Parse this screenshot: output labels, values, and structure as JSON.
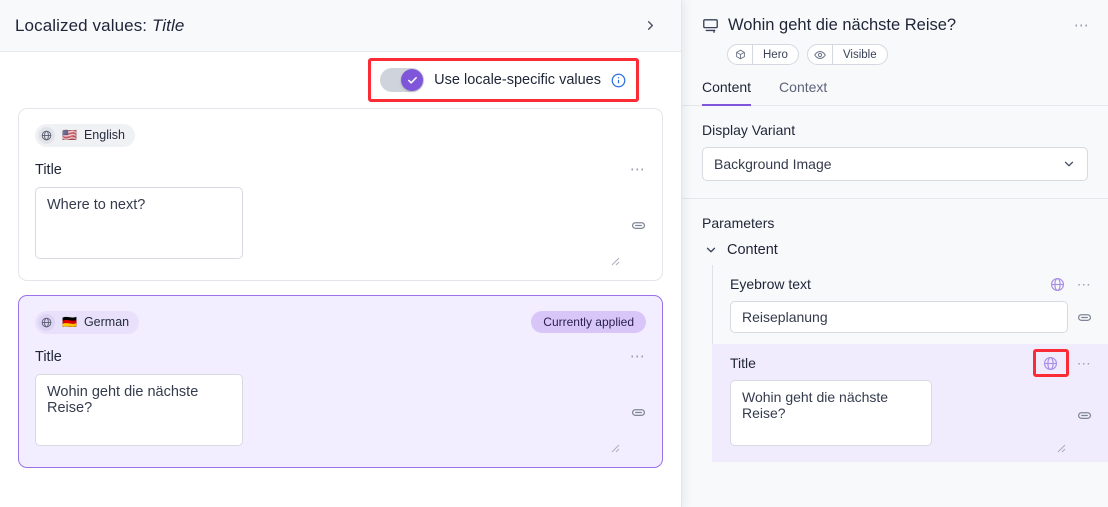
{
  "left_panel": {
    "header": {
      "title_prefix": "Localized values:",
      "title_value": "Title",
      "collapse_icon": "chevron-right-icon"
    },
    "toggle": {
      "label": "Use locale-specific values",
      "state": "on",
      "info_icon": "info-circle-icon",
      "annotation_color": "#fb2c36"
    },
    "locale_cards": [
      {
        "globe_icon": "globe-icon",
        "flag": "🇺🇸",
        "locale_name": "English",
        "badge": "",
        "field_label": "Title",
        "value": "Where to next?",
        "menu_icon": "ellipsis-icon",
        "link_icon": "link-icon",
        "applied": false
      },
      {
        "globe_icon": "globe-icon",
        "flag": "🇩🇪",
        "locale_name": "German",
        "badge": "Currently applied",
        "field_label": "Title",
        "value": "Wohin geht die nächste Reise?",
        "menu_icon": "ellipsis-icon",
        "link_icon": "link-icon",
        "applied": true
      }
    ]
  },
  "right_panel": {
    "header": {
      "icon": "section-layout-icon",
      "title": "Wohin geht die nächste Reise?",
      "menu_icon": "ellipsis-icon",
      "badges": [
        {
          "icon": "cube-icon",
          "label": "Hero"
        },
        {
          "icon": "eye-icon",
          "label": "Visible"
        }
      ]
    },
    "tabs": [
      {
        "label": "Content",
        "active": true
      },
      {
        "label": "Context",
        "active": false
      }
    ],
    "display_variant": {
      "label": "Display Variant",
      "value": "Background Image",
      "caret_icon": "chevron-down-icon"
    },
    "parameters": {
      "label": "Parameters",
      "groups": [
        {
          "name": "Content",
          "expanded": true,
          "caret_icon": "chevron-down-icon",
          "params": [
            {
              "name": "Eyebrow text",
              "value": "Reiseplanung",
              "type": "input",
              "globe_icon": "globe-icon",
              "menu_icon": "ellipsis-icon",
              "link_icon": "link-icon",
              "highlighted": false,
              "annotated": false
            },
            {
              "name": "Title",
              "value": "Wohin geht die nächste Reise?",
              "type": "textarea",
              "globe_icon": "globe-icon",
              "menu_icon": "ellipsis-icon",
              "link_icon": "link-icon",
              "highlighted": true,
              "annotated": true
            }
          ]
        }
      ]
    }
  },
  "colors": {
    "accent_purple": "#7f56d9",
    "highlight_lavender": "#f1ecfd",
    "annotation_red": "#fb2c36",
    "badge_purple": "#d9c6f8",
    "info_blue": "#2f6fe4"
  }
}
